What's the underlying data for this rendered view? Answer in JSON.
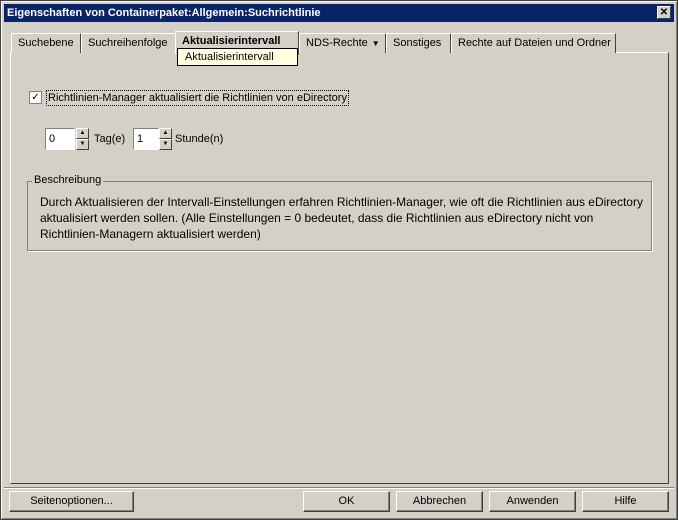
{
  "window": {
    "title": "Eigenschaften von Containerpaket:Allgemein:Suchrichtlinie",
    "close_glyph": "✕"
  },
  "tabs": [
    {
      "label": "Suchebene"
    },
    {
      "label": "Suchreihenfolge"
    },
    {
      "label": "Aktualisierintervall"
    },
    {
      "label": "NDS-Rechte"
    },
    {
      "label": "Sonstiges"
    },
    {
      "label": "Rechte auf Dateien und Ordner"
    }
  ],
  "active_tab_index": 2,
  "tooltip": {
    "text": "Aktualisierintervall"
  },
  "checkbox": {
    "label": "Richtlinien-Manager aktualisiert die Richtlinien von eDirectory",
    "checked": true,
    "mark": "✓"
  },
  "interval": {
    "days_value": "0",
    "days_label": "Tag(e)",
    "hours_value": "1",
    "hours_label": "Stunde(n)"
  },
  "description": {
    "title": "Beschreibung",
    "text": "Durch Aktualisieren der Intervall-Einstellungen erfahren Richtlinien-Manager, wie oft die Richtlinien aus eDirectory aktualisiert werden sollen. (Alle Einstellungen = 0 bedeutet, dass die Richtlinien aus eDirectory nicht von Richtlinien-Managern aktualisiert werden)"
  },
  "buttons": {
    "page_options": "Seitenoptionen...",
    "ok": "OK",
    "cancel": "Abbrechen",
    "apply": "Anwenden",
    "help": "Hilfe"
  },
  "colors": {
    "title_bar": "#0a246a",
    "face": "#d4d0c8",
    "tooltip_bg": "#ffffe1"
  }
}
